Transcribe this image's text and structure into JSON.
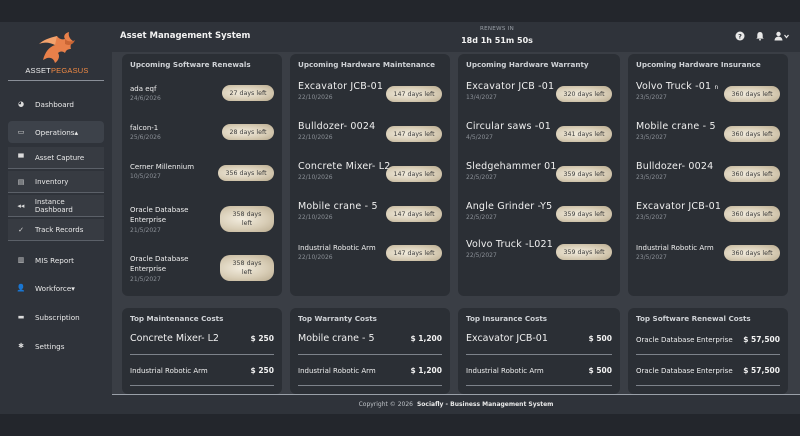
{
  "sidebar": {
    "logo_text_a": "ASSET",
    "logo_text_b": "PEGASUS",
    "dashboard": "Dashboard",
    "operations": "Operations▴",
    "asset_capture": "Asset Capture",
    "inventory": "Inventory",
    "instance_dashboard": "Instance Dashboard",
    "track_records": "Track Records",
    "mis_report": "MIS Report",
    "workforce": "Workforce▾",
    "subscription": "Subscription",
    "settings": "Settings"
  },
  "header": {
    "title": "Asset Management System",
    "renews_label": "RENEWS IN",
    "renews_value": "18d 1h 51m 50s"
  },
  "cards": {
    "software": {
      "title": "Upcoming Software Renewals",
      "items": [
        {
          "name": "ada eqf",
          "date": "24/6/2026",
          "days": "27 days left"
        },
        {
          "name": "falcon-1",
          "date": "25/6/2026",
          "days": "28 days left"
        },
        {
          "name": "Cerner Millennium",
          "date": "10/5/2027",
          "days": "356 days left"
        },
        {
          "name": "Oracle Database Enterprise",
          "date": "21/5/2027",
          "days": "358 days left"
        },
        {
          "name": "Oracle Database Enterprise",
          "date": "21/5/2027",
          "days": "358 days left"
        }
      ]
    },
    "maintenance": {
      "title": "Upcoming Hardware Maintenance",
      "items": [
        {
          "name": "Excavator JCB-01",
          "date": "22/10/2026",
          "days": "147 days left"
        },
        {
          "name": "Bulldozer- 0024",
          "date": "22/10/2026",
          "days": "147 days left"
        },
        {
          "name": "Concrete Mixer- L2",
          "date": "22/10/2026",
          "days": "147 days left"
        },
        {
          "name": "Mobile crane - 5",
          "date": "22/10/2026",
          "days": "147 days left"
        },
        {
          "name": "Industrial Robotic Arm",
          "date": "22/10/2026",
          "days": "147 days left"
        }
      ]
    },
    "warranty": {
      "title": "Upcoming Hardware Warranty",
      "items": [
        {
          "name": "Excavator JCB -01",
          "date": "13/4/2027",
          "days": "320 days left"
        },
        {
          "name": "Circular saws -01",
          "date": "4/5/2027",
          "days": "341 days left"
        },
        {
          "name": "Sledgehammer 01",
          "date": "22/5/2027",
          "days": "359 days left"
        },
        {
          "name": "Angle Grinder -Y5",
          "date": "22/5/2027",
          "days": "359 days left"
        },
        {
          "name": "Volvo Truck -L021",
          "date": "22/5/2027",
          "days": "359 days left"
        }
      ]
    },
    "insurance": {
      "title": "Upcoming Hardware Insurance",
      "items": [
        {
          "name": "Volvo Truck -01",
          "suffix": "n",
          "date": "23/5/2027",
          "days": "360 days left"
        },
        {
          "name": "Mobile crane - 5",
          "date": "23/5/2027",
          "days": "360 days left"
        },
        {
          "name": "Bulldozer- 0024",
          "date": "23/5/2027",
          "days": "360 days left"
        },
        {
          "name": "Excavator JCB-01",
          "date": "23/5/2027",
          "days": "360 days left"
        },
        {
          "name": "Industrial Robotic Arm",
          "date": "23/5/2027",
          "days": "360 days left"
        }
      ]
    }
  },
  "costs": {
    "maintenance": {
      "title": "Top Maintenance Costs",
      "items": [
        {
          "name": "Concrete Mixer- L2",
          "amount": "$ 250"
        },
        {
          "name": "Industrial Robotic Arm",
          "amount": "$ 250"
        }
      ]
    },
    "warranty": {
      "title": "Top Warranty Costs",
      "items": [
        {
          "name": "Mobile crane - 5",
          "amount": "$ 1,200"
        },
        {
          "name": "Industrial Robotic Arm",
          "amount": "$ 1,200"
        }
      ]
    },
    "insurance": {
      "title": "Top Insurance Costs",
      "items": [
        {
          "name": "Excavator JCB-01",
          "amount": "$ 500"
        },
        {
          "name": "Industrial Robotic Arm",
          "amount": "$ 500"
        }
      ]
    },
    "software": {
      "title": "Top Software Renewal Costs",
      "items": [
        {
          "name": "Oracle Database Enterprise",
          "amount": "$ 57,500"
        },
        {
          "name": "Oracle Database Enterprise",
          "amount": "$ 57,500"
        }
      ]
    }
  },
  "footer": {
    "copyright": "Copyright © 2026",
    "brand": "Sociafly - Business Management System"
  },
  "colors": {
    "accent": "#f08a44",
    "pill": "#d8cdb6"
  },
  "icons": [
    "dashboard-icon",
    "operations-icon",
    "cart-icon",
    "inventory-icon",
    "instance-icon",
    "check-icon",
    "report-icon",
    "user-plus-icon",
    "subscription-icon",
    "gear-icon",
    "help-icon",
    "bell-icon",
    "user-icon"
  ]
}
